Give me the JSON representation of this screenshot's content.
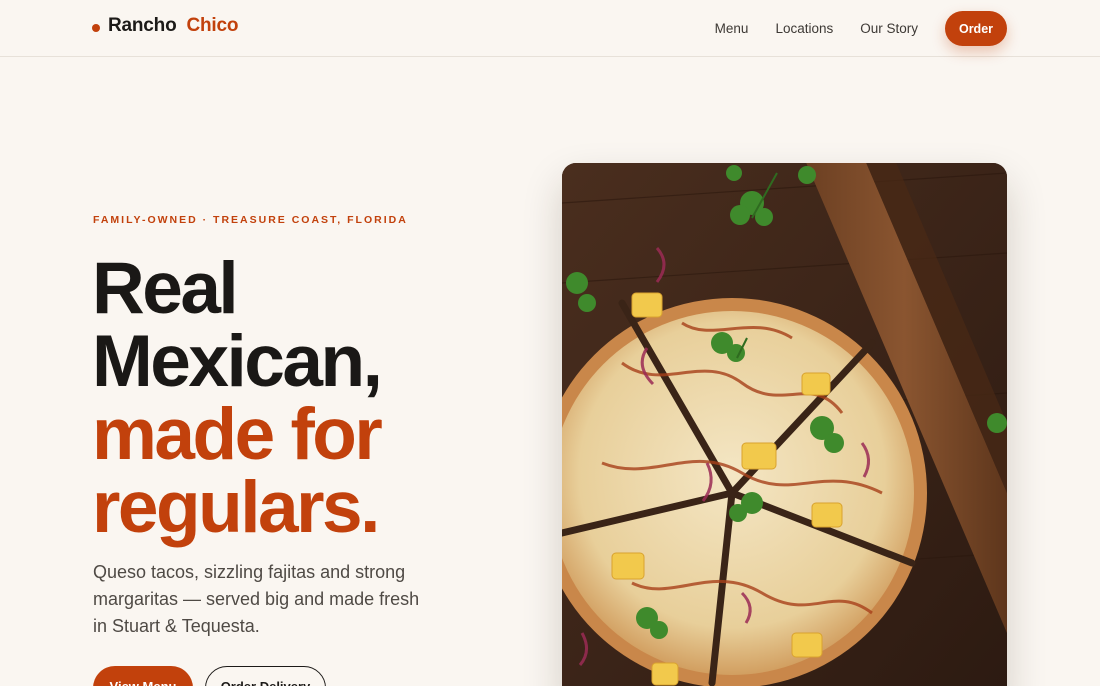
{
  "brand": {
    "first": "Rancho",
    "second": "Chico",
    "accent_color": "#c2410c"
  },
  "nav": {
    "items": [
      "Menu",
      "Locations",
      "Our Story"
    ],
    "order_label": "Order"
  },
  "hero": {
    "eyebrow": "FAMILY-OWNED · TREASURE COAST, FLORIDA",
    "headline_dark_1": "Real",
    "headline_dark_2": "Mexican,",
    "headline_accent_1": "made for",
    "headline_accent_2": "regulars.",
    "lede": "Queso tacos, sizzling fajitas and strong margaritas — served big and made fresh in Stuart & Tequesta.",
    "primary_cta": "View Menu",
    "secondary_cta": "Order Delivery",
    "image": "pizza-photo"
  }
}
